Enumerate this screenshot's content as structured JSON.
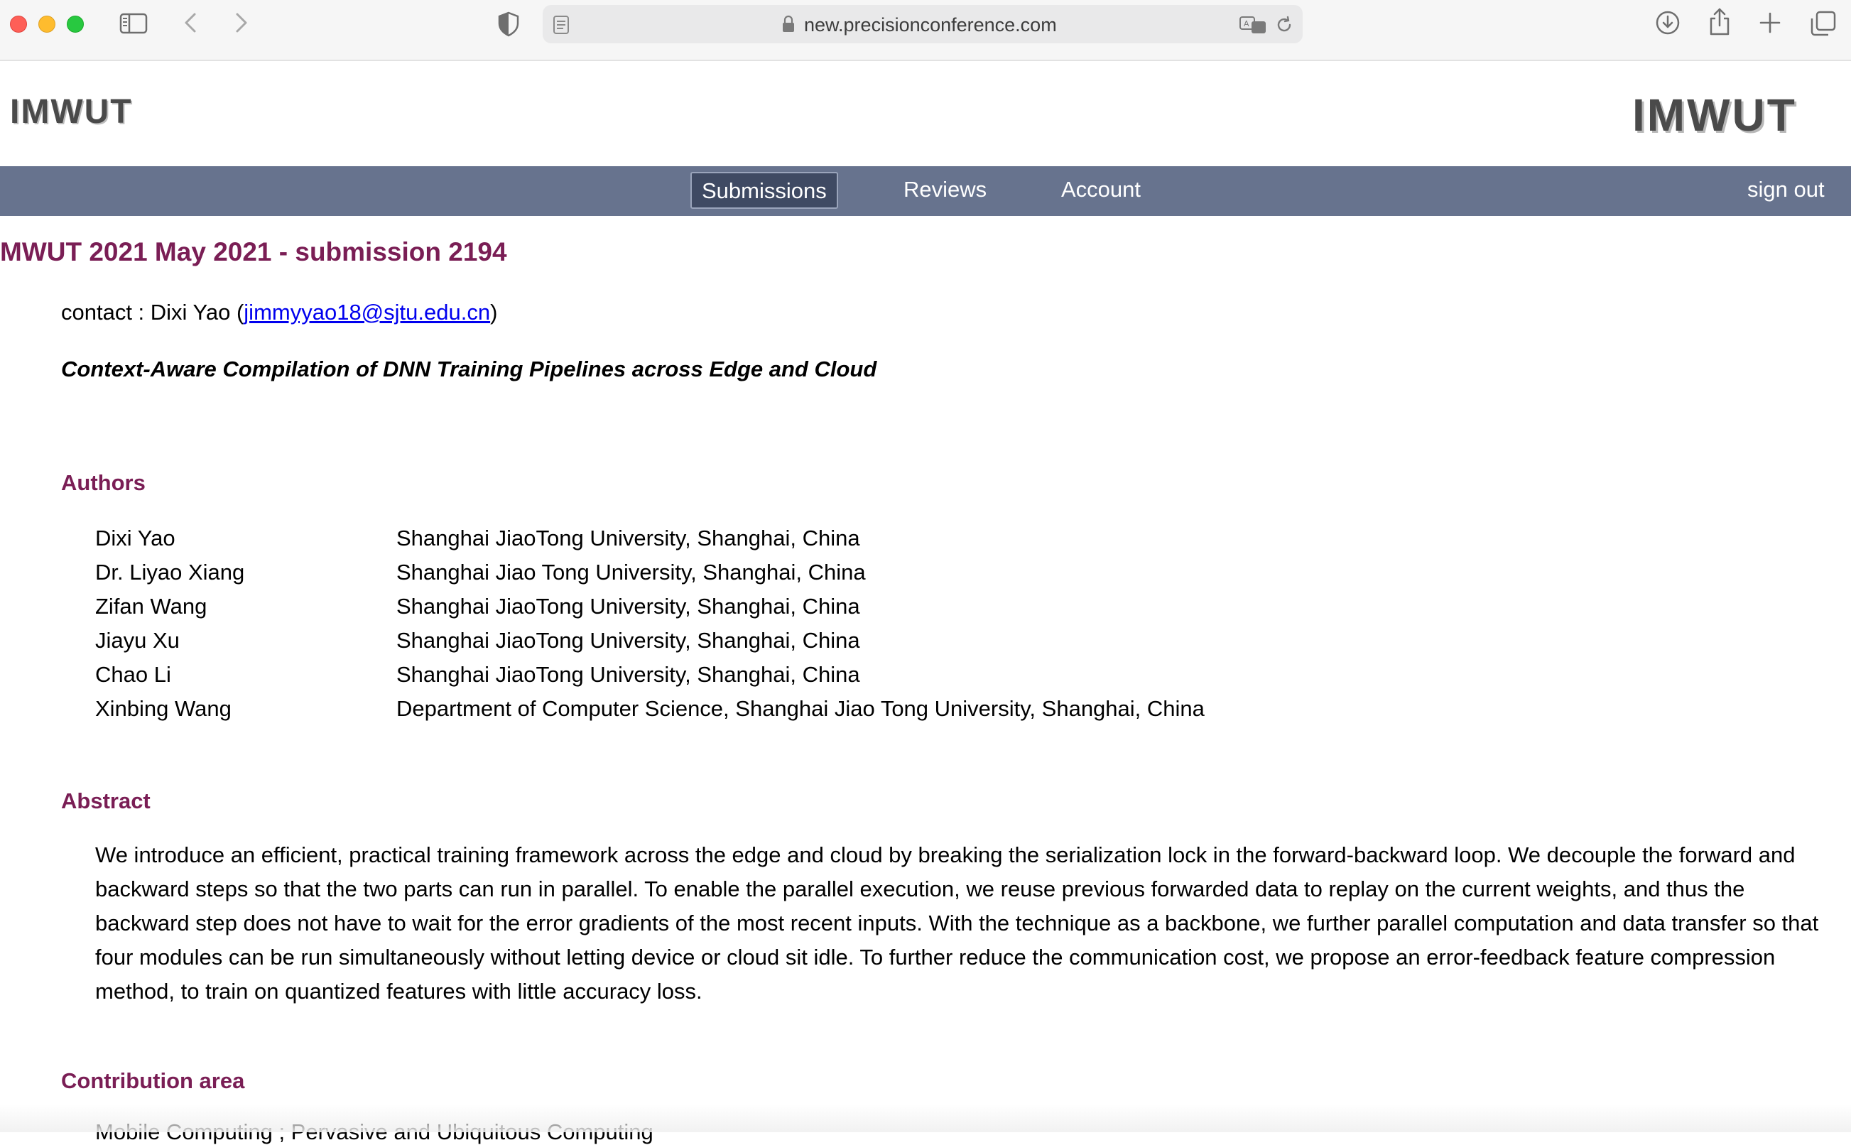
{
  "browser": {
    "url": "new.precisionconference.com"
  },
  "site": {
    "logo_left": "IMWUT",
    "logo_right": "IMWUT"
  },
  "nav": {
    "submissions": "Submissions",
    "reviews": "Reviews",
    "account": "Account",
    "sign_out": "sign out"
  },
  "page": {
    "title": "MWUT 2021 May 2021 - submission 2194",
    "contact_prefix": "contact : Dixi Yao (",
    "contact_email": "jimmyyao18@sjtu.edu.cn",
    "contact_suffix": ")",
    "paper_title": "Context-Aware Compilation of DNN Training Pipelines across Edge and Cloud",
    "authors_heading": "Authors",
    "authors": [
      {
        "name": "Dixi Yao",
        "affiliation": "Shanghai JiaoTong University, Shanghai, China"
      },
      {
        "name": "Dr. Liyao Xiang",
        "affiliation": "Shanghai Jiao Tong University, Shanghai, China"
      },
      {
        "name": "Zifan Wang",
        "affiliation": "Shanghai JiaoTong University, Shanghai, China"
      },
      {
        "name": "Jiayu Xu",
        "affiliation": "Shanghai JiaoTong University, Shanghai, China"
      },
      {
        "name": "Chao Li",
        "affiliation": "Shanghai JiaoTong University, Shanghai, China"
      },
      {
        "name": "Xinbing Wang",
        "affiliation": "Department of Computer Science, Shanghai Jiao Tong University, Shanghai, China"
      }
    ],
    "abstract_heading": "Abstract",
    "abstract": "We introduce an efficient, practical training framework across the edge and cloud by breaking the serialization lock in the forward-backward loop. We decouple the forward and backward steps so that the two parts can run in parallel. To enable the parallel execution, we reuse previous forwarded data to replay on the current weights, and thus the backward step does not have to wait for the error gradients of the most recent inputs. With the technique as a backbone, we further parallel computation and data transfer so that four modules can be run simultaneously without letting device or cloud sit idle. To further reduce the communication cost, we propose an error-feedback feature compression method, to train on quantized features with little accuracy loss.",
    "contribution_heading": "Contribution area",
    "contribution_item": "Mobile Computing ; Pervasive and Ubiquitous Computing"
  },
  "colors": {
    "accent": "#7a1e55",
    "navbar": "#67738e",
    "nav_active": "#3f4a63",
    "link": "#0000ee"
  },
  "icons": [
    "sidebar-icon",
    "back-icon",
    "forward-icon",
    "shield-icon",
    "reader-icon",
    "lock-icon",
    "translate-icon",
    "reload-icon",
    "download-icon",
    "share-icon",
    "new-tab-icon",
    "tabs-overview-icon"
  ]
}
